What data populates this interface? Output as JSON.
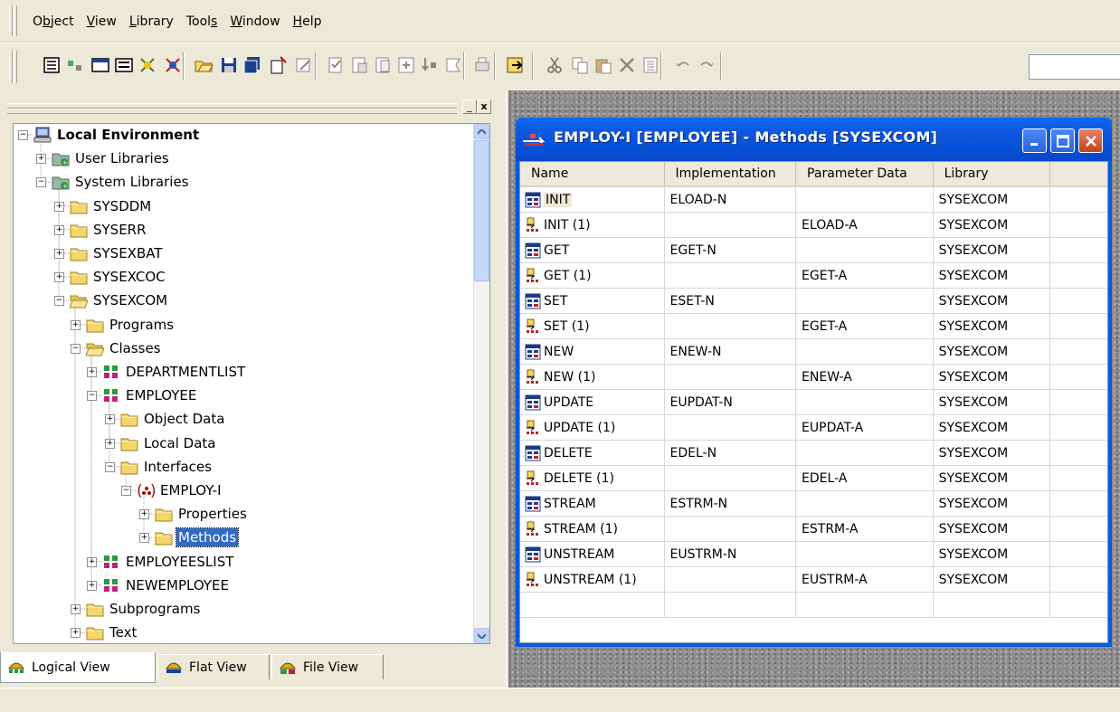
{
  "menu": [
    "Object",
    "View",
    "Library",
    "Tools",
    "Window",
    "Help"
  ],
  "menu_access_keys": [
    "b",
    "V",
    "L",
    "s",
    "W",
    "H"
  ],
  "toolbar": {
    "icons": [
      "properties-icon",
      "environment-icon",
      "window-icon",
      "list-view-icon",
      "connect-icon",
      "disconnect-icon",
      "open-icon",
      "save-icon",
      "save-all-icon",
      "new-icon",
      "edit-icon",
      "check-icon",
      "stow-icon",
      "catalog-icon",
      "run-icon",
      "debug-icon",
      "stow-all-icon",
      "print-icon",
      "exit-icon",
      "cut-icon",
      "copy-icon",
      "paste-icon",
      "delete-icon",
      "select-all-icon",
      "undo-icon",
      "redo-icon"
    ]
  },
  "tree": {
    "nodes": [
      {
        "label": "Local Environment",
        "level": 0,
        "expanded": true,
        "bold": true,
        "icon": "computer-icon"
      },
      {
        "label": "User Libraries",
        "level": 1,
        "expanded": false,
        "icon": "library-icon"
      },
      {
        "label": "System Libraries",
        "level": 1,
        "expanded": true,
        "icon": "library-icon"
      },
      {
        "label": "SYSDDM",
        "level": 2,
        "expanded": false,
        "icon": "folder-icon"
      },
      {
        "label": "SYSERR",
        "level": 2,
        "expanded": false,
        "icon": "folder-icon"
      },
      {
        "label": "SYSEXBAT",
        "level": 2,
        "expanded": false,
        "icon": "folder-icon"
      },
      {
        "label": "SYSEXCOC",
        "level": 2,
        "expanded": false,
        "icon": "folder-icon"
      },
      {
        "label": "SYSEXCOM",
        "level": 2,
        "expanded": true,
        "icon": "folder-open-icon"
      },
      {
        "label": "Programs",
        "level": 3,
        "expanded": false,
        "icon": "folder-icon"
      },
      {
        "label": "Classes",
        "level": 3,
        "expanded": true,
        "icon": "folder-open-icon"
      },
      {
        "label": "DEPARTMENTLIST",
        "level": 4,
        "expanded": false,
        "icon": "class-icon"
      },
      {
        "label": "EMPLOYEE",
        "level": 4,
        "expanded": true,
        "icon": "class-icon"
      },
      {
        "label": "Object Data",
        "level": 5,
        "expanded": false,
        "icon": "folder-icon"
      },
      {
        "label": "Local Data",
        "level": 5,
        "expanded": false,
        "icon": "folder-icon"
      },
      {
        "label": "Interfaces",
        "level": 5,
        "expanded": true,
        "icon": "folder-icon"
      },
      {
        "label": "EMPLOY-I",
        "level": 6,
        "expanded": true,
        "icon": "interface-icon"
      },
      {
        "label": "Properties",
        "level": 7,
        "expanded": false,
        "icon": "folder-icon"
      },
      {
        "label": "Methods",
        "level": 7,
        "expanded": false,
        "icon": "folder-icon",
        "selected": true
      },
      {
        "label": "EMPLOYEESLIST",
        "level": 4,
        "expanded": false,
        "icon": "class-icon"
      },
      {
        "label": "NEWEMPLOYEE",
        "level": 4,
        "expanded": false,
        "icon": "class-icon"
      },
      {
        "label": "Subprograms",
        "level": 3,
        "expanded": false,
        "icon": "folder-icon"
      },
      {
        "label": "Text",
        "level": 3,
        "expanded": false,
        "icon": "folder-icon"
      }
    ]
  },
  "tabs": [
    {
      "label": "Logical View",
      "active": true,
      "icon": "logical-view-icon"
    },
    {
      "label": "Flat View",
      "active": false,
      "icon": "flat-view-icon"
    },
    {
      "label": "File View",
      "active": false,
      "icon": "file-view-icon"
    }
  ],
  "child_window": {
    "title": "EMPLOY-I [EMPLOYEE] - Methods  [SYSEXCOM]",
    "columns": [
      "Name",
      "Implementation",
      "Parameter Data",
      "Library",
      ""
    ],
    "rows": [
      {
        "name": "INIT",
        "impl": "ELOAD-N",
        "param": "",
        "library": "SYSEXCOM",
        "kind": "method"
      },
      {
        "name": "INIT (1)",
        "impl": "",
        "param": "ELOAD-A",
        "library": "SYSEXCOM",
        "kind": "param"
      },
      {
        "name": "GET",
        "impl": "EGET-N",
        "param": "",
        "library": "SYSEXCOM",
        "kind": "method"
      },
      {
        "name": "GET (1)",
        "impl": "",
        "param": "EGET-A",
        "library": "SYSEXCOM",
        "kind": "param"
      },
      {
        "name": "SET",
        "impl": "ESET-N",
        "param": "",
        "library": "SYSEXCOM",
        "kind": "method"
      },
      {
        "name": "SET (1)",
        "impl": "",
        "param": "EGET-A",
        "library": "SYSEXCOM",
        "kind": "param"
      },
      {
        "name": "NEW",
        "impl": "ENEW-N",
        "param": "",
        "library": "SYSEXCOM",
        "kind": "method"
      },
      {
        "name": "NEW (1)",
        "impl": "",
        "param": "ENEW-A",
        "library": "SYSEXCOM",
        "kind": "param"
      },
      {
        "name": "UPDATE",
        "impl": "EUPDAT-N",
        "param": "",
        "library": "SYSEXCOM",
        "kind": "method"
      },
      {
        "name": "UPDATE (1)",
        "impl": "",
        "param": "EUPDAT-A",
        "library": "SYSEXCOM",
        "kind": "param"
      },
      {
        "name": "DELETE",
        "impl": "EDEL-N",
        "param": "",
        "library": "SYSEXCOM",
        "kind": "method"
      },
      {
        "name": "DELETE (1)",
        "impl": "",
        "param": "EDEL-A",
        "library": "SYSEXCOM",
        "kind": "param"
      },
      {
        "name": "STREAM",
        "impl": "ESTRM-N",
        "param": "",
        "library": "SYSEXCOM",
        "kind": "method"
      },
      {
        "name": "STREAM (1)",
        "impl": "",
        "param": "ESTRM-A",
        "library": "SYSEXCOM",
        "kind": "param"
      },
      {
        "name": "UNSTREAM",
        "impl": "EUSTRM-N",
        "param": "",
        "library": "SYSEXCOM",
        "kind": "method"
      },
      {
        "name": "UNSTREAM (1)",
        "impl": "",
        "param": "EUSTRM-A",
        "library": "SYSEXCOM",
        "kind": "param"
      },
      {
        "name": "",
        "impl": "",
        "param": "",
        "library": "",
        "kind": "empty"
      }
    ]
  },
  "colors": {
    "selection": "#316ac5",
    "title_bar": "#0a57e0",
    "folder": "#f5d66a"
  }
}
